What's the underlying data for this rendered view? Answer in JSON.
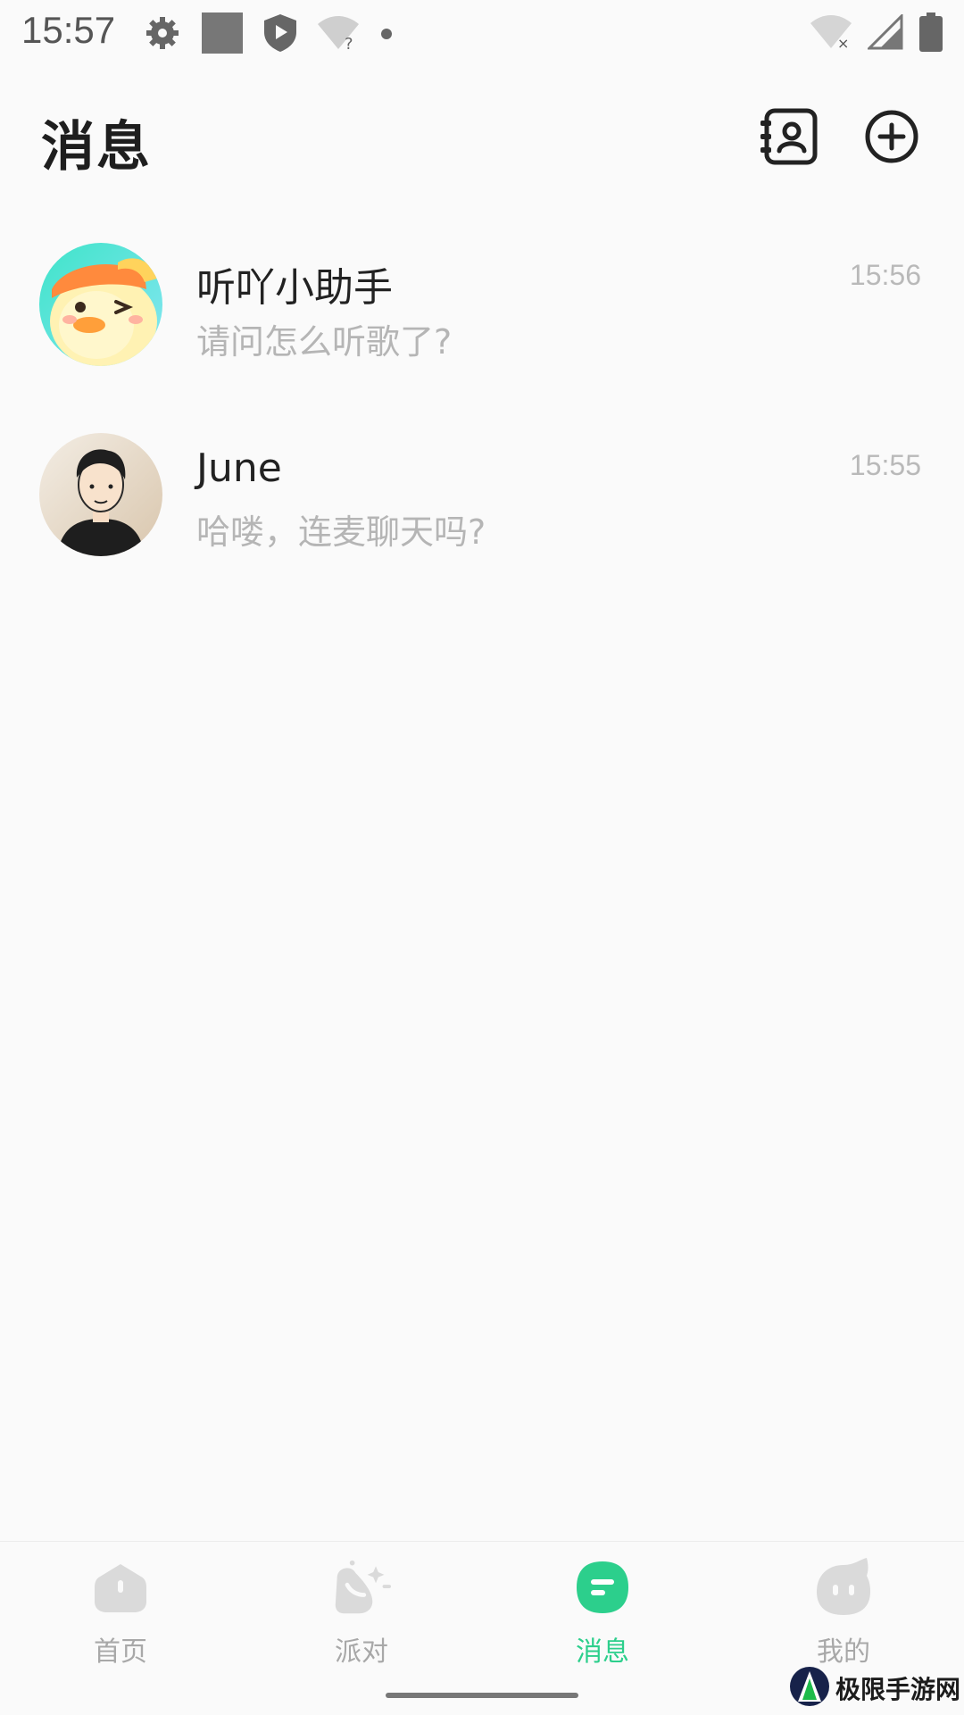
{
  "status_bar": {
    "time": "15:57",
    "icons_left": [
      "gear-icon",
      "square-icon",
      "shield-play-icon",
      "wifi-unknown-icon",
      "dot-icon"
    ],
    "icons_right": [
      "wifi-off-icon",
      "signal-icon",
      "battery-icon"
    ]
  },
  "header": {
    "title": "消息",
    "actions": [
      "contacts-icon",
      "add-circle-icon"
    ]
  },
  "conversations": [
    {
      "name": "听吖小助手",
      "preview": "请问怎么听歌了?",
      "time": "15:56",
      "avatar": "duck-avatar"
    },
    {
      "name": "June",
      "preview": "哈喽，连麦聊天吗?",
      "time": "15:55",
      "avatar": "person-avatar"
    }
  ],
  "bottom_nav": {
    "items": [
      {
        "label": "首页",
        "icon": "home-icon",
        "active": false
      },
      {
        "label": "派对",
        "icon": "party-icon",
        "active": false
      },
      {
        "label": "消息",
        "icon": "message-icon",
        "active": true
      },
      {
        "label": "我的",
        "icon": "profile-icon",
        "active": false
      }
    ]
  },
  "watermark": {
    "text": "极限手游网"
  },
  "colors": {
    "accent": "#2ccf8c",
    "inactive": "#d9d9d9",
    "preview_text": "#b5b5b5"
  }
}
